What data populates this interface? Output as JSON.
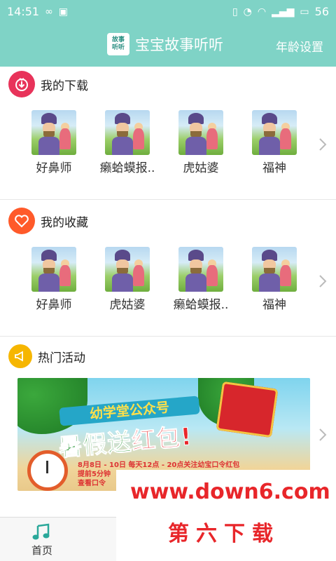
{
  "status_bar": {
    "time": "14:51",
    "left_icons": [
      "infinity-icon",
      "image-icon"
    ],
    "right_icons": [
      "vibrate-icon",
      "alarm-icon",
      "wifi-icon",
      "signal-icon",
      "battery-icon"
    ],
    "battery": "56"
  },
  "app_bar": {
    "logo_text_top": "故事",
    "logo_text_bottom": "听听",
    "title": "宝宝故事听听",
    "age_setting": "年龄设置"
  },
  "downloads": {
    "title": "我的下载",
    "items": [
      {
        "label": "好鼻师"
      },
      {
        "label": "癞蛤蟆报.."
      },
      {
        "label": "虎姑婆"
      },
      {
        "label": "福神"
      }
    ]
  },
  "favorites": {
    "title": "我的收藏",
    "items": [
      {
        "label": "好鼻师"
      },
      {
        "label": "虎姑婆"
      },
      {
        "label": "癞蛤蟆报.."
      },
      {
        "label": "福神"
      }
    ]
  },
  "hot_events": {
    "title": "热门活动",
    "banner": {
      "ribbon": "幼学堂公众号",
      "headline_part1": "暑假送",
      "headline_part2": "红包!",
      "fine_line1": "8月8日 - 10日   每天12点 - 20点关注幼宝口令红包",
      "fine_line2": "提前5分钟",
      "fine_line3": "查看口令"
    }
  },
  "bottom_nav": {
    "home_label": "首页"
  },
  "watermark": {
    "url": "www.down6.com",
    "name": "第六下载"
  },
  "colors": {
    "header": "#7fd3c6",
    "download_icon": "#e8335a",
    "favorite_icon": "#ff5a2a",
    "hot_icon": "#f6b600",
    "watermark": "#e8262a"
  }
}
